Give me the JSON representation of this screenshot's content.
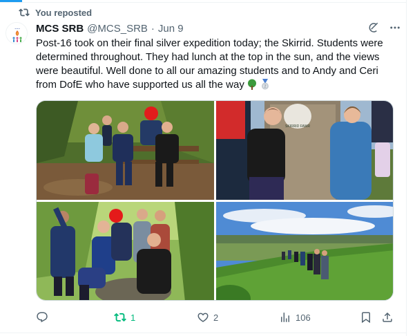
{
  "repost_banner": {
    "text": "You reposted",
    "icon": "repost-icon"
  },
  "author": {
    "name": "MCS SRB",
    "handle": "@MCS_SRB",
    "separator": "·",
    "date": "Jun 9",
    "avatar": "school-logo-avatar"
  },
  "tweet": {
    "text": "Post-16 took on their final silver expedition today; the Skirrid. Students were determined throughout. They had lunch at the top in the sun, and the views were beautiful. Well done to all our amazing students and to Andy and Ceri from DofE who have supported us all the way",
    "emojis": [
      "tree-emoji",
      "medal-emoji"
    ]
  },
  "header_icons": [
    "grok-icon",
    "more-options-icon"
  ],
  "media": {
    "photos": [
      {
        "subject": "students on bench in woods"
      },
      {
        "subject": "students at trig point"
      },
      {
        "subject": "group posing on rock"
      },
      {
        "subject": "students walking along ridge"
      }
    ],
    "sign_text": "SKIRRID FAWR"
  },
  "actions": {
    "reply": {
      "icon": "reply-icon",
      "count": ""
    },
    "repost": {
      "icon": "repost-icon",
      "count": "1",
      "active_color": "#00ba7c"
    },
    "like": {
      "icon": "heart-icon",
      "count": "2"
    },
    "views": {
      "icon": "views-icon",
      "count": "106"
    },
    "bookmark": {
      "icon": "bookmark-icon"
    },
    "share": {
      "icon": "share-icon"
    }
  },
  "colors": {
    "text": "#0f1419",
    "muted": "#536471",
    "accent": "#1d9bf0",
    "repost_green": "#00ba7c",
    "border": "#cfd9de"
  }
}
